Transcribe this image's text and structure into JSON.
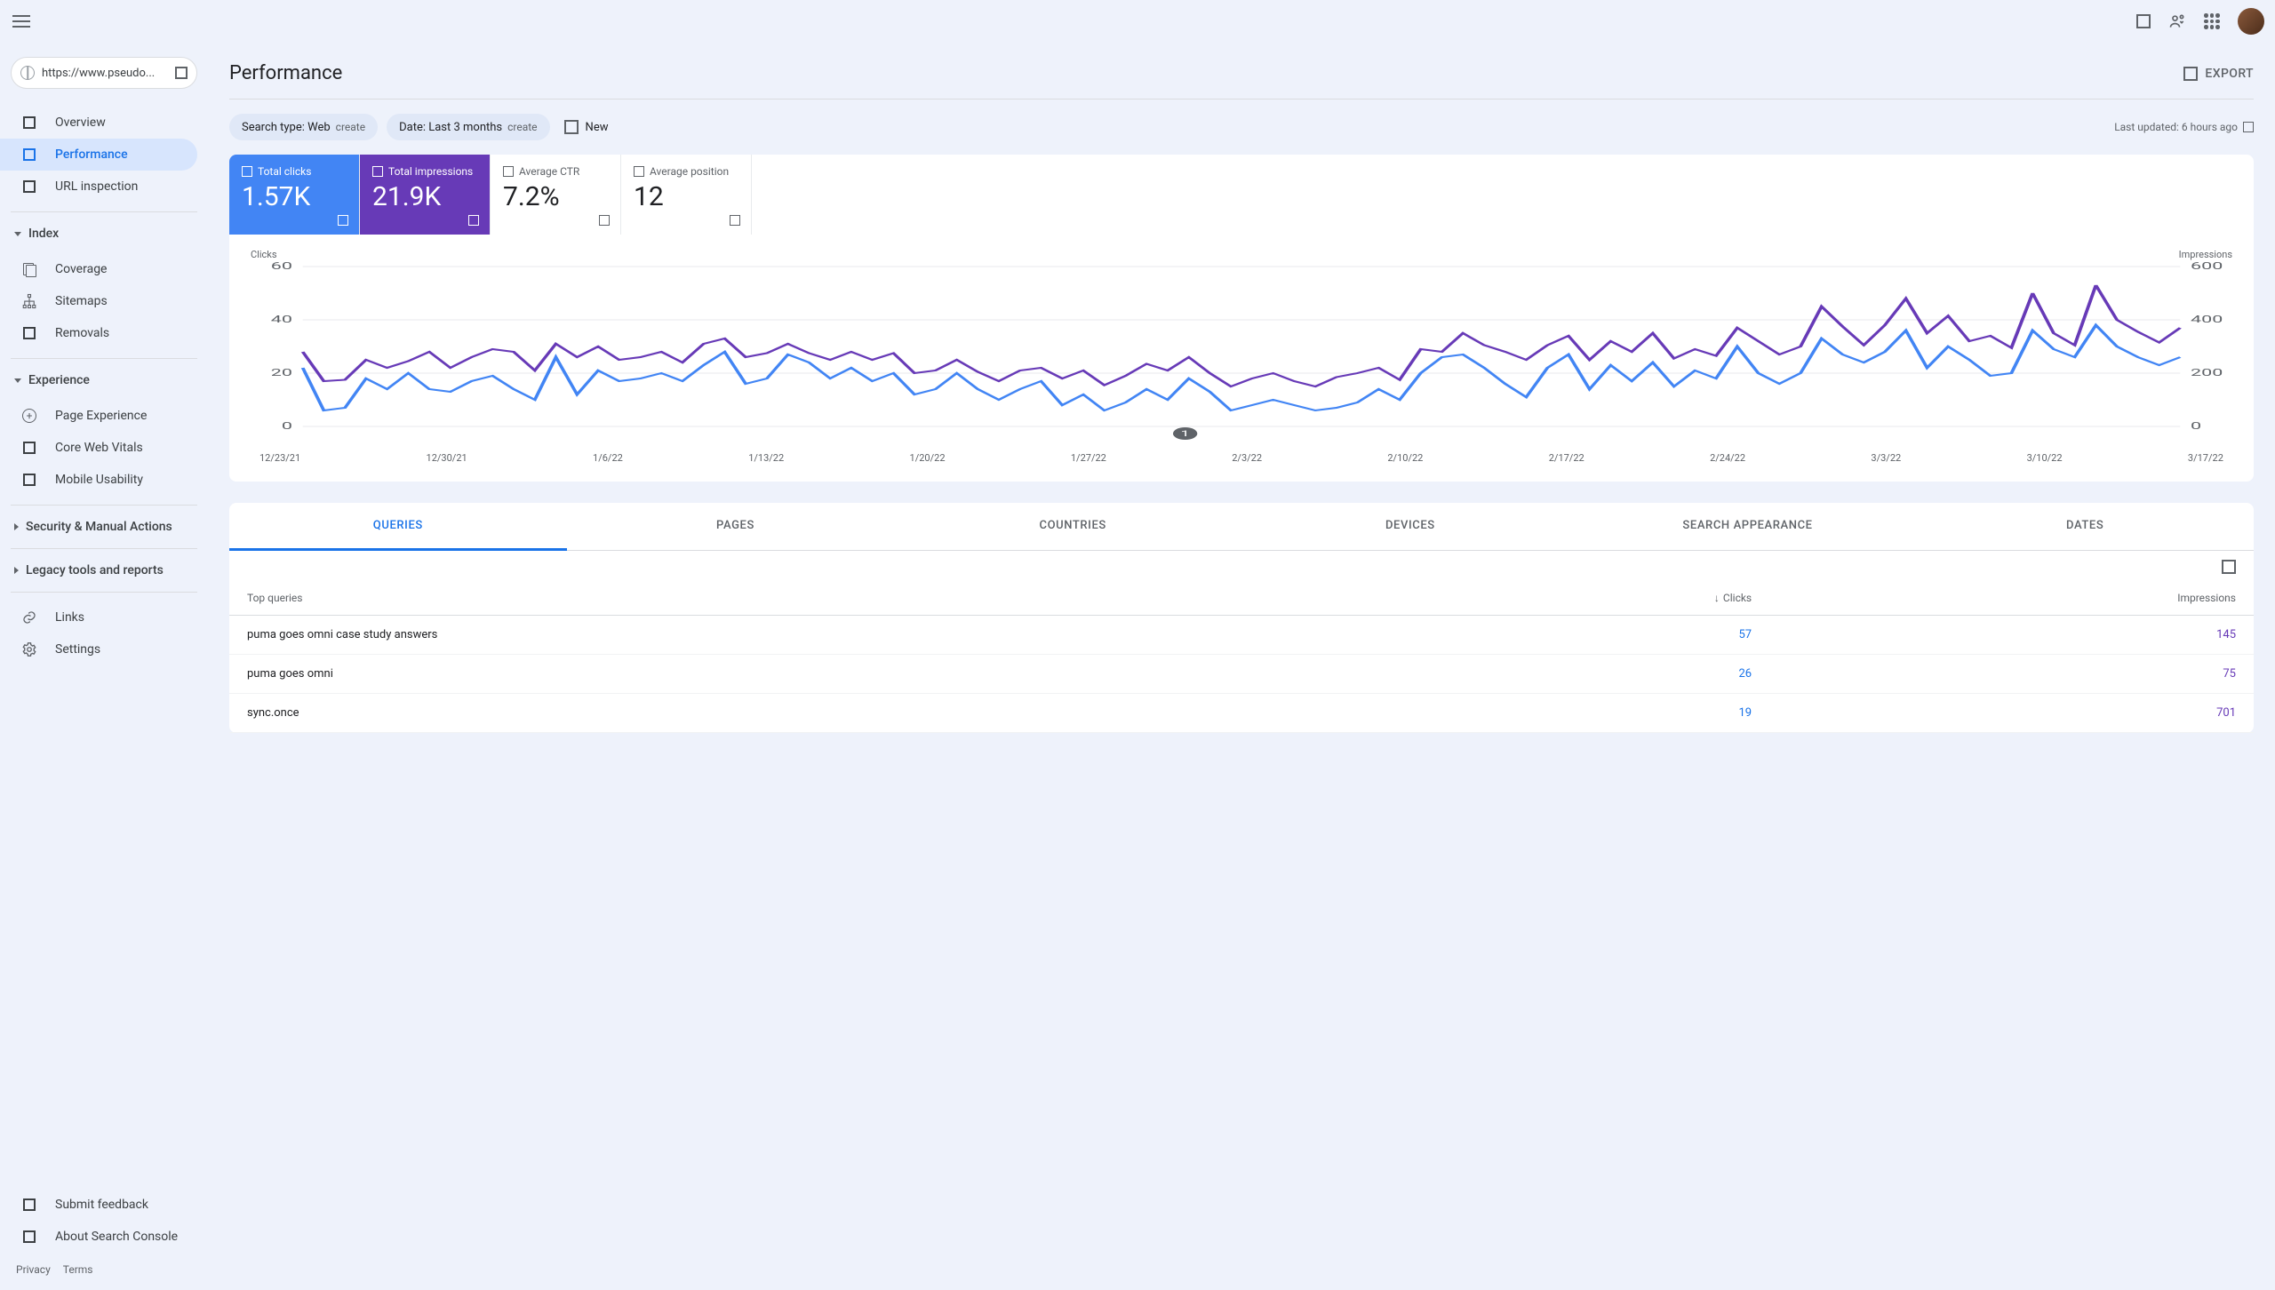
{
  "topbar": {
    "property_url": "https://www.pseudo..."
  },
  "sidebar": {
    "top_items": [
      {
        "label": "Overview",
        "icon": "box"
      },
      {
        "label": "Performance",
        "icon": "box",
        "active": true
      },
      {
        "label": "URL inspection",
        "icon": "box"
      }
    ],
    "sections": [
      {
        "header": "Index",
        "items": [
          {
            "label": "Coverage",
            "icon": "coverage"
          },
          {
            "label": "Sitemaps",
            "icon": "sitemaps"
          },
          {
            "label": "Removals",
            "icon": "box"
          }
        ]
      },
      {
        "header": "Experience",
        "items": [
          {
            "label": "Page Experience",
            "icon": "plus"
          },
          {
            "label": "Core Web Vitals",
            "icon": "box"
          },
          {
            "label": "Mobile Usability",
            "icon": "box"
          }
        ]
      }
    ],
    "collapsed_sections": [
      "Security & Manual Actions",
      "Legacy tools and reports"
    ],
    "extra_items": [
      {
        "label": "Links",
        "icon": "links"
      },
      {
        "label": "Settings",
        "icon": "settings"
      }
    ],
    "bottom_items": [
      {
        "label": "Submit feedback",
        "icon": "box"
      },
      {
        "label": "About Search Console",
        "icon": "box"
      }
    ],
    "footer": {
      "privacy": "Privacy",
      "terms": "Terms"
    }
  },
  "header": {
    "title": "Performance",
    "export_label": "EXPORT"
  },
  "filters": {
    "search_type": {
      "label": "Search type: Web",
      "action": "create"
    },
    "date": {
      "label": "Date: Last 3 months",
      "action": "create"
    },
    "new_label": "New",
    "last_updated": "Last updated: 6 hours ago"
  },
  "metrics": {
    "clicks": {
      "label": "Total clicks",
      "value": "1.57K"
    },
    "impressions": {
      "label": "Total impressions",
      "value": "21.9K"
    },
    "ctr": {
      "label": "Average CTR",
      "value": "7.2%"
    },
    "position": {
      "label": "Average position",
      "value": "12"
    }
  },
  "chart_data": {
    "type": "line",
    "left_axis_label": "Clicks",
    "right_axis_label": "Impressions",
    "left_ticks": [
      60,
      40,
      20,
      0
    ],
    "right_ticks": [
      600,
      400,
      200,
      0
    ],
    "x_labels": [
      "12/23/21",
      "12/30/21",
      "1/6/22",
      "1/13/22",
      "1/20/22",
      "1/27/22",
      "2/3/22",
      "2/10/22",
      "2/17/22",
      "2/24/22",
      "3/3/22",
      "3/10/22",
      "3/17/22"
    ],
    "series": [
      {
        "name": "Clicks",
        "axis": "left",
        "color": "#4285f4",
        "values": [
          22,
          6,
          7,
          18,
          14,
          20,
          14,
          13,
          17,
          19,
          14,
          10,
          26,
          12,
          21,
          17,
          18,
          20,
          17,
          23,
          28,
          16,
          18,
          27,
          24,
          18,
          22,
          17,
          20,
          12,
          14,
          20,
          14,
          10,
          14,
          17,
          8,
          12,
          6,
          9,
          14,
          10,
          18,
          13,
          6,
          8,
          10,
          8,
          6,
          7,
          9,
          14,
          10,
          20,
          26,
          27,
          22,
          16,
          11,
          22,
          27,
          14,
          23,
          17,
          24,
          15,
          21,
          18,
          30,
          20,
          16,
          20,
          33,
          27,
          24,
          28,
          36,
          22,
          30,
          25,
          19,
          20,
          36,
          29,
          26,
          38,
          30,
          26,
          23,
          26
        ]
      },
      {
        "name": "Impressions",
        "axis": "right",
        "color": "#673ab7",
        "values": [
          280,
          170,
          175,
          250,
          220,
          245,
          280,
          220,
          260,
          290,
          280,
          210,
          310,
          260,
          300,
          250,
          260,
          280,
          240,
          310,
          330,
          260,
          275,
          310,
          275,
          250,
          280,
          250,
          275,
          200,
          210,
          250,
          205,
          170,
          210,
          220,
          180,
          210,
          155,
          190,
          235,
          210,
          260,
          200,
          150,
          180,
          200,
          170,
          150,
          185,
          200,
          220,
          175,
          290,
          280,
          350,
          305,
          280,
          250,
          305,
          340,
          250,
          320,
          280,
          350,
          255,
          290,
          265,
          370,
          320,
          270,
          300,
          450,
          375,
          305,
          380,
          480,
          350,
          415,
          320,
          340,
          295,
          500,
          350,
          305,
          530,
          400,
          355,
          315,
          370
        ]
      }
    ],
    "marker_label": "1"
  },
  "tabs": [
    "QUERIES",
    "PAGES",
    "COUNTRIES",
    "DEVICES",
    "SEARCH APPEARANCE",
    "DATES"
  ],
  "active_tab": 0,
  "table": {
    "columns": {
      "query": "Top queries",
      "clicks": "Clicks",
      "impressions": "Impressions"
    },
    "rows": [
      {
        "q": "puma goes omni case study answers",
        "c": "57",
        "i": "145"
      },
      {
        "q": "puma goes omni",
        "c": "26",
        "i": "75"
      },
      {
        "q": "sync.once",
        "c": "19",
        "i": "701"
      }
    ]
  }
}
